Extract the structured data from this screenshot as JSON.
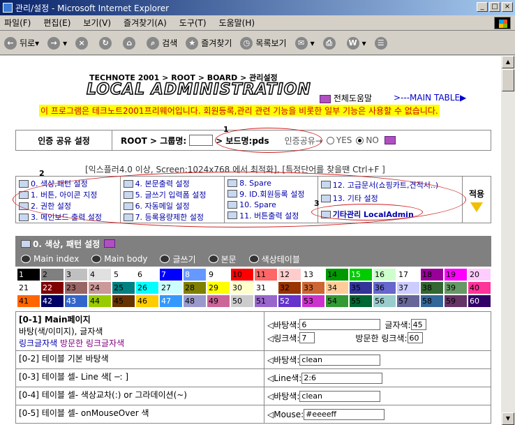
{
  "window": {
    "title": "관리/설정 - Microsoft Internet Explorer"
  },
  "menubar": [
    "파일(F)",
    "편집(E)",
    "보기(V)",
    "즐겨찾기(A)",
    "도구(T)",
    "도움말(H)"
  ],
  "toolbar": {
    "back": "뒤로",
    "search": "검색",
    "favorites": "즐겨찾기",
    "history": "목록보기"
  },
  "header": {
    "breadcrumb": "TECHNOTE 2001 > ROOT > BOARD > 관리설정",
    "logo": "LOCAL ADMINISTRATION",
    "help": "전체도움말",
    "main_table": ">---MAIN TABLE▶",
    "notice": "이 프로그램은 테크노트2001프리웨어입니다. 회원등록,관리 관련 기능을 비롯한 일부 기능은 사용할 수 없습니다."
  },
  "auth": {
    "label": "인증 공유 설정",
    "path_prefix": "ROOT > 그룹명:",
    "group_value": "",
    "board": "> 보드명:pds",
    "share_label": "인증공유→",
    "yes": "YES",
    "no": "NO"
  },
  "annotations": [
    "1",
    "2",
    "3"
  ],
  "hint": "[익스플러4.0 이상, Screen:1024x768 에서 최적화], [특정단어를 찾을땐 Ctrl+F ]",
  "menu": {
    "col1": [
      "0. 색상,패턴 설정",
      "1. 버튼, 아이콘 지정",
      "2. 권한 설정",
      "3. 메인보드 출력 설정"
    ],
    "col2": [
      "4. 본문출력 설정",
      "5. 글쓰기 입력폼 설정",
      "6. 자동메일 설정",
      "7. 등록용량제한 설정"
    ],
    "col3": [
      "8. Spare",
      "9. ID.회원등록 설정",
      "10. Spare",
      "11. 버튼출력 설정"
    ],
    "col4": [
      "12. 고급문서(쇼핑카트,견적서..)",
      "13. 기타 설정",
      "",
      "기타관리 LocalAdmin"
    ],
    "apply": "적용"
  },
  "section": {
    "title": "0. 색상, 패턴 설정",
    "tabs": [
      "Main index",
      "Main body",
      "글쓰기",
      "본문",
      "색상테이블"
    ]
  },
  "palette": [
    {
      "n": "1",
      "bg": "#000000",
      "fg": "#ffffff"
    },
    {
      "n": "2",
      "bg": "#808080",
      "fg": "#000000"
    },
    {
      "n": "3",
      "bg": "#c0c0c0",
      "fg": "#000000"
    },
    {
      "n": "4",
      "bg": "#e0e0e0",
      "fg": "#000000"
    },
    {
      "n": "5",
      "bg": "#ffffff",
      "fg": "#000000"
    },
    {
      "n": "6",
      "bg": "#ffffff",
      "fg": "#000000"
    },
    {
      "n": "7",
      "bg": "#0000ff",
      "fg": "#ffffff"
    },
    {
      "n": "8",
      "bg": "#6699ff",
      "fg": "#ffffff"
    },
    {
      "n": "9",
      "bg": "#ffffff",
      "fg": "#000000"
    },
    {
      "n": "10",
      "bg": "#ff0000",
      "fg": "#000000"
    },
    {
      "n": "11",
      "bg": "#ff6666",
      "fg": "#000000"
    },
    {
      "n": "12",
      "bg": "#ffcccc",
      "fg": "#000000"
    },
    {
      "n": "13",
      "bg": "#ffffff",
      "fg": "#000000"
    },
    {
      "n": "14",
      "bg": "#009900",
      "fg": "#000000"
    },
    {
      "n": "15",
      "bg": "#00cc00",
      "fg": "#ffffff"
    },
    {
      "n": "16",
      "bg": "#ccffcc",
      "fg": "#000000"
    },
    {
      "n": "17",
      "bg": "#ffffff",
      "fg": "#000000"
    },
    {
      "n": "18",
      "bg": "#990099",
      "fg": "#000000"
    },
    {
      "n": "19",
      "bg": "#ff00ff",
      "fg": "#000000"
    },
    {
      "n": "20",
      "bg": "#ffccff",
      "fg": "#000000"
    },
    {
      "n": "21",
      "bg": "#ffffff",
      "fg": "#000000"
    },
    {
      "n": "22",
      "bg": "#800000",
      "fg": "#ffffff"
    },
    {
      "n": "23",
      "bg": "#996666",
      "fg": "#000000"
    },
    {
      "n": "24",
      "bg": "#cc9999",
      "fg": "#000000"
    },
    {
      "n": "25",
      "bg": "#008080",
      "fg": "#000000"
    },
    {
      "n": "26",
      "bg": "#00ffff",
      "fg": "#000000"
    },
    {
      "n": "27",
      "bg": "#ccffff",
      "fg": "#000000"
    },
    {
      "n": "28",
      "bg": "#808000",
      "fg": "#000000"
    },
    {
      "n": "29",
      "bg": "#ffff00",
      "fg": "#000000"
    },
    {
      "n": "30",
      "bg": "#ffffcc",
      "fg": "#000000"
    },
    {
      "n": "31",
      "bg": "#ffffff",
      "fg": "#000000"
    },
    {
      "n": "32",
      "bg": "#993300",
      "fg": "#000000"
    },
    {
      "n": "33",
      "bg": "#cc6633",
      "fg": "#000000"
    },
    {
      "n": "34",
      "bg": "#ffcc99",
      "fg": "#000000"
    },
    {
      "n": "35",
      "bg": "#333399",
      "fg": "#000000"
    },
    {
      "n": "36",
      "bg": "#6666cc",
      "fg": "#000000"
    },
    {
      "n": "37",
      "bg": "#ccccff",
      "fg": "#000000"
    },
    {
      "n": "38",
      "bg": "#336633",
      "fg": "#000000"
    },
    {
      "n": "39",
      "bg": "#669966",
      "fg": "#000000"
    },
    {
      "n": "40",
      "bg": "#ff3399",
      "fg": "#000000"
    },
    {
      "n": "41",
      "bg": "#ff6600",
      "fg": "#000000"
    },
    {
      "n": "42",
      "bg": "#000066",
      "fg": "#ffffff"
    },
    {
      "n": "43",
      "bg": "#3366cc",
      "fg": "#ffffff"
    },
    {
      "n": "44",
      "bg": "#99cc00",
      "fg": "#000000"
    },
    {
      "n": "45",
      "bg": "#663300",
      "fg": "#000000"
    },
    {
      "n": "46",
      "bg": "#ffcc00",
      "fg": "#000000"
    },
    {
      "n": "47",
      "bg": "#3399ff",
      "fg": "#ffffff"
    },
    {
      "n": "48",
      "bg": "#9999cc",
      "fg": "#000000"
    },
    {
      "n": "49",
      "bg": "#cc6699",
      "fg": "#000000"
    },
    {
      "n": "50",
      "bg": "#cccccc",
      "fg": "#000000"
    },
    {
      "n": "51",
      "bg": "#9966cc",
      "fg": "#000000"
    },
    {
      "n": "52",
      "bg": "#6633cc",
      "fg": "#ffffff"
    },
    {
      "n": "53",
      "bg": "#cc33cc",
      "fg": "#000000"
    },
    {
      "n": "54",
      "bg": "#339933",
      "fg": "#000000"
    },
    {
      "n": "55",
      "bg": "#006633",
      "fg": "#000000"
    },
    {
      "n": "56",
      "bg": "#99cccc",
      "fg": "#000000"
    },
    {
      "n": "57",
      "bg": "#666699",
      "fg": "#000000"
    },
    {
      "n": "58",
      "bg": "#336699",
      "fg": "#000000"
    },
    {
      "n": "59",
      "bg": "#663366",
      "fg": "#000000"
    },
    {
      "n": "60",
      "bg": "#330066",
      "fg": "#ffffff"
    }
  ],
  "rows": [
    {
      "title": "[0-1] Main페이지",
      "sub": "바탕(색/이미지), 글자색",
      "sub2": "링크글자색",
      "sub3": "방문한 링크글자색",
      "f1": "◁바탕색:",
      "v1": "6",
      "f2": "글자색:",
      "v2": "45",
      "f3": "◁링크색:",
      "v3": "7",
      "f4": "방문한 링크색:",
      "v4": "60"
    },
    {
      "title": "[0-2] 테이블 기본 바탕색",
      "f1": "◁바탕색:",
      "v1": "clean"
    },
    {
      "title": "[0-3] 테이블 셀- Line 색[ ─:  ]",
      "f1": "◁Line색:",
      "v1": "2:6"
    },
    {
      "title": "[0-4] 테이블 셀- 색상교차(:) or 그라데이션(~)",
      "f1": "◁바탕색:",
      "v1": "clean"
    },
    {
      "title": "[0-5] 테이블 셀- onMouseOver 색",
      "f1": "◁Mouse:",
      "v1": "#eeeeff"
    }
  ]
}
